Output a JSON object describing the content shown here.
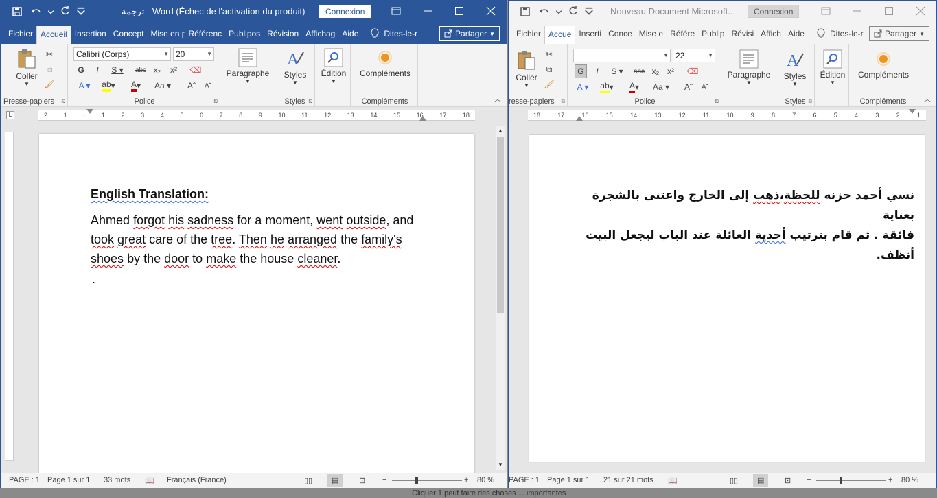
{
  "left_window": {
    "title": "ترجمة  -  Word (Échec de l'activation du produit)",
    "connexion": "Connexion",
    "tabs": [
      "Fichier",
      "Accueil",
      "Insertion",
      "Concept",
      "Mise en p",
      "Référenc",
      "Publipos",
      "Révision",
      "Affichag",
      "Aide"
    ],
    "tell_me": "Dites-le-r",
    "share": "Partager",
    "ribbon": {
      "coller": "Coller",
      "presse_papiers": "Presse-papiers",
      "font_name": "Calibri (Corps)",
      "font_size": "20",
      "police": "Police",
      "paragraphe": "Paragraphe",
      "styles_btn": "Styles",
      "styles_group": "Styles",
      "edition": "Édition",
      "complements_btn": "Compléments",
      "complements_group": "Compléments"
    },
    "ruler_ticks": [
      "2",
      "1",
      "",
      "1",
      "2",
      "3",
      "4",
      "5",
      "6",
      "7",
      "8",
      "9",
      "10",
      "11",
      "12",
      "13",
      "14",
      "15",
      "16",
      "17",
      "18"
    ],
    "document": {
      "heading": "English Translation:",
      "w": [
        "Ahmed",
        "forgot",
        "his",
        "sadness",
        "for a moment,",
        "went",
        "outside",
        ", and",
        "took",
        "great",
        "care of the",
        "tree",
        ".",
        "Then",
        "he",
        "arranged",
        "the",
        "family's",
        "shoes",
        "by the",
        "door",
        "to",
        "make",
        "the house",
        "cleaner",
        "."
      ],
      "cursor_line": "."
    },
    "status": {
      "page": "PAGE : 1",
      "page_of": "Page 1 sur 1",
      "words": "33 mots",
      "language": "Français (France)",
      "zoom": "80 %"
    }
  },
  "right_window": {
    "title": "Nouveau Document Microsoft...",
    "connexion": "Connexion",
    "tabs": [
      "Fichier",
      "Accue",
      "Inserti",
      "Conce",
      "Mise e",
      "Référe",
      "Publip",
      "Révisi",
      "Affich",
      "Aide"
    ],
    "tell_me": "Dites-le-r",
    "share": "Partager",
    "ribbon": {
      "coller": "Coller",
      "presse_papiers": "resse-papiers",
      "font_name": "",
      "font_size": "22",
      "police": "Police",
      "paragraphe": "Paragraphe",
      "styles_btn": "Styles",
      "styles_group": "Styles",
      "edition": "Édition",
      "complements_btn": "Compléments",
      "complements_group": "Compléments"
    },
    "ruler_ticks": [
      "18",
      "17",
      "16",
      "15",
      "14",
      "13",
      "12",
      "11",
      "10",
      "9",
      "8",
      "7",
      "6",
      "5",
      "4",
      "3",
      "2",
      "1"
    ],
    "document": {
      "a": [
        "نسي أحمد حزنه ",
        "للحظة",
        "،",
        "ذهب",
        "إلى الخارج واعتنى بالشجرة بعناية"
      ],
      "b": [
        "فائقة . ثم قام بترتيب ",
        "أحدية",
        " العائلة عند الباب ليجعل البيت أنظف."
      ]
    },
    "status": {
      "page": "PAGE : 1",
      "page_of": "Page 1 sur 1",
      "words": "21 sur 21 mots",
      "zoom": "80 %"
    }
  },
  "background_text": "Cliquer 1 peut faire des choses ... importantes"
}
